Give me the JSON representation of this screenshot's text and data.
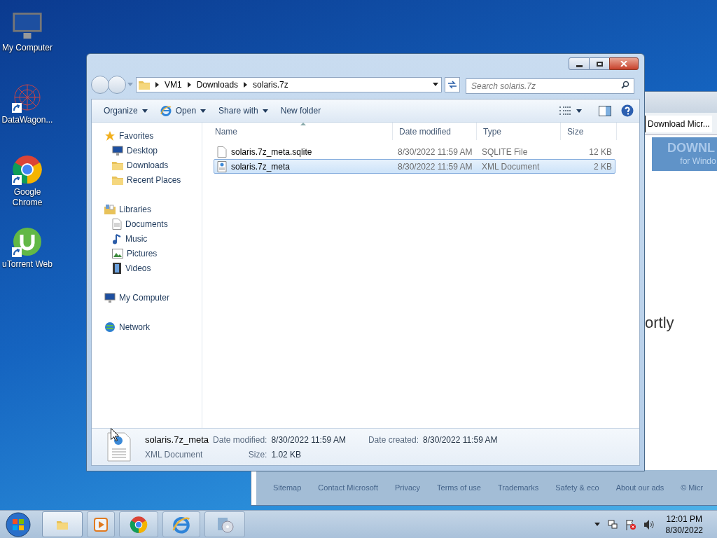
{
  "desktop_icons": [
    {
      "label": "My Computer"
    },
    {
      "label": "DataWagon..."
    },
    {
      "label": "Google Chrome"
    },
    {
      "label": "uTorrent Web"
    }
  ],
  "browser_window": {
    "tab_title": "Download Micr...",
    "banner_title": "DOWNL",
    "banner_subtitle": "for Windo",
    "body_text": "ortly",
    "footer_links": [
      "Sitemap",
      "Contact Microsoft",
      "Privacy",
      "Terms of use",
      "Trademarks",
      "Safety & eco",
      "About our ads",
      "© Micr"
    ]
  },
  "explorer": {
    "breadcrumb": [
      "VM1",
      "Downloads",
      "solaris.7z"
    ],
    "search": {
      "placeholder": "Search solaris.7z"
    },
    "toolbar": [
      {
        "label": "Organize",
        "kind": "dropdown"
      },
      {
        "label": "Open",
        "kind": "dropdown"
      },
      {
        "label": "Share with",
        "kind": "dropdown"
      },
      {
        "label": "New folder",
        "kind": "button"
      }
    ],
    "navigation": [
      {
        "label": "Favorites",
        "children": [
          {
            "label": "Desktop"
          },
          {
            "label": "Downloads"
          },
          {
            "label": "Recent Places"
          }
        ]
      },
      {
        "label": "Libraries",
        "children": [
          {
            "label": "Documents"
          },
          {
            "label": "Music"
          },
          {
            "label": "Pictures"
          },
          {
            "label": "Videos"
          }
        ]
      },
      {
        "label": "My Computer"
      },
      {
        "label": "Network"
      }
    ],
    "columns": [
      {
        "label": "Name",
        "sorted": true
      },
      {
        "label": "Date modified",
        "sorted": false
      },
      {
        "label": "Type",
        "sorted": false
      },
      {
        "label": "Size",
        "sorted": false
      }
    ],
    "rows": [
      {
        "name": "solaris.7z_meta.sqlite",
        "date": "8/30/2022 11:59 AM",
        "type": "SQLITE File",
        "size": "12 KB",
        "kind": "file",
        "selected": false
      },
      {
        "name": "solaris.7z_meta",
        "date": "8/30/2022 11:59 AM",
        "type": "XML Document",
        "size": "2 KB",
        "kind": "xml",
        "selected": true
      }
    ],
    "details": {
      "name": "solaris.7z_meta",
      "type": "XML Document",
      "fields": [
        {
          "label": "Date modified:",
          "value": "8/30/2022 11:59 AM"
        },
        {
          "label": "Date created:",
          "value": "8/30/2022 11:59 AM"
        },
        {
          "label": "Size:",
          "value": "1.02 KB"
        }
      ]
    }
  },
  "taskbar": {
    "buttons": [
      {
        "selected": true
      },
      {
        "selected": false
      },
      {
        "selected": false
      },
      {
        "selected": false
      },
      {
        "selected": false
      }
    ],
    "time": "12:01 PM",
    "date": "8/30/2022"
  }
}
